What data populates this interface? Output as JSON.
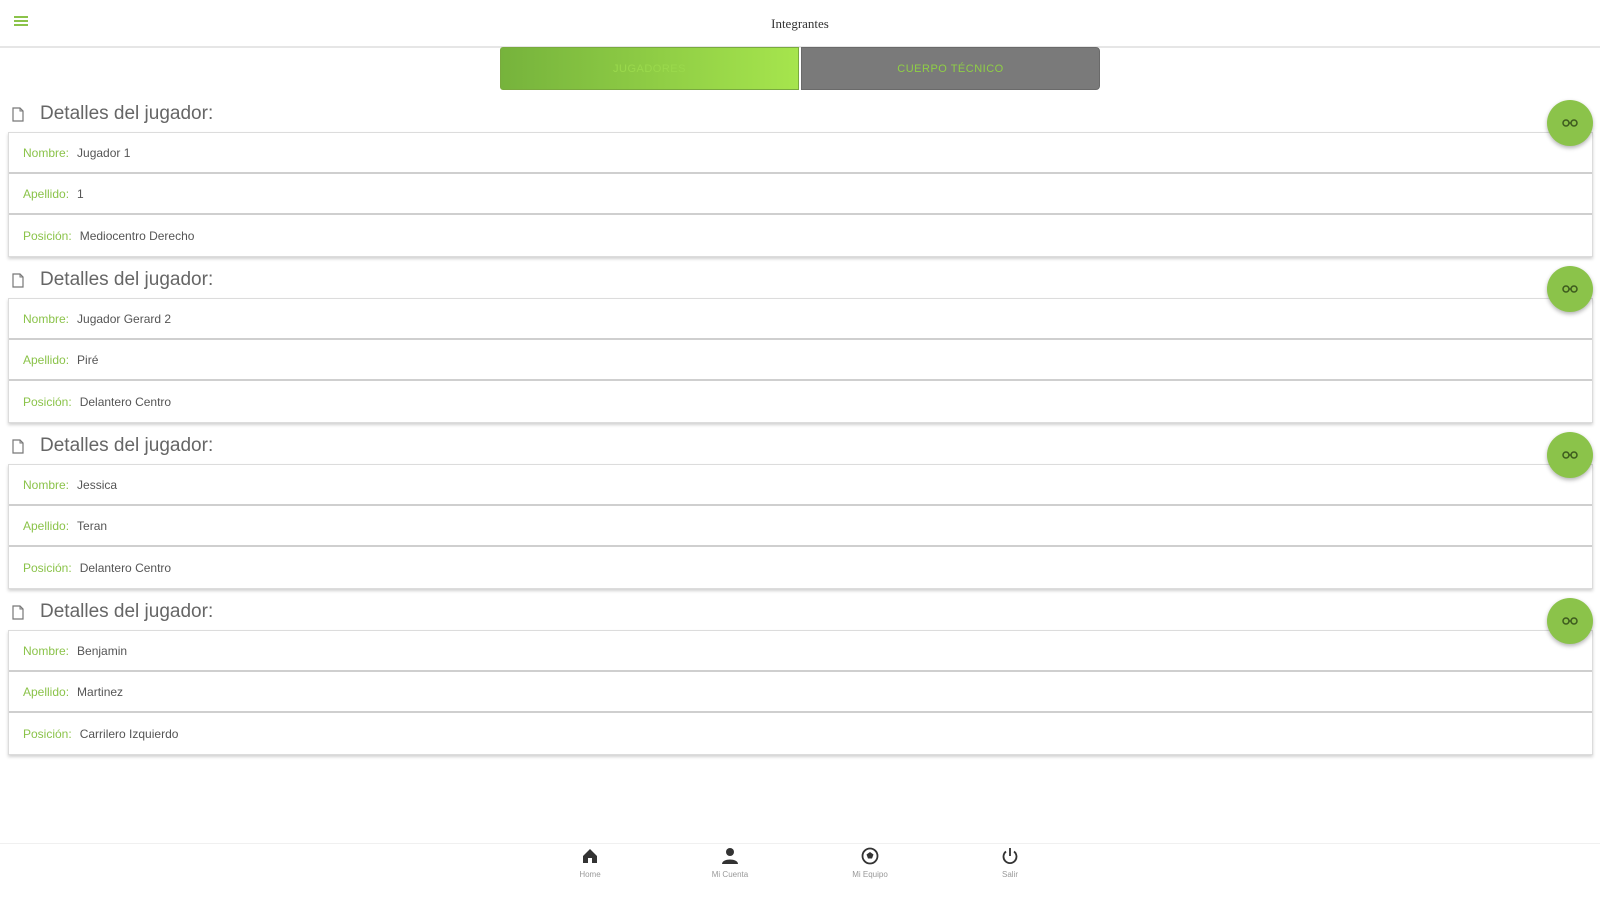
{
  "header": {
    "title": "Integrantes",
    "menu_icon": "hamburger-menu-icon"
  },
  "tabs": [
    {
      "label": "JUGADORES",
      "active": true
    },
    {
      "label": "CUERPO TÉCNICO",
      "active": false
    }
  ],
  "field_labels": {
    "nombre": "Nombre:",
    "apellido": "Apellido:",
    "posicion": "Posición:"
  },
  "players": [
    {
      "card_title": "Detalles del jugador:",
      "nombre": "Jugador 1",
      "apellido": "1",
      "posicion": "Mediocentro Derecho"
    },
    {
      "card_title": "Detalles del jugador:",
      "nombre": "Jugador Gerard 2",
      "apellido": "Piré",
      "posicion": "Delantero Centro"
    },
    {
      "card_title": "Detalles del jugador:",
      "nombre": "Jessica",
      "apellido": "Teran",
      "posicion": "Delantero Centro"
    },
    {
      "card_title": "Detalles del jugador:",
      "nombre": "Benjamin",
      "apellido": "Martinez",
      "posicion": "Carrilero Izquierdo"
    }
  ],
  "fab_icon": "glasses-view-icon",
  "bottom_nav": [
    {
      "label": "Home",
      "icon": "home-icon"
    },
    {
      "label": "Mi Cuenta",
      "icon": "person-icon"
    },
    {
      "label": "Mi Equipo",
      "icon": "soccer-ball-icon"
    },
    {
      "label": "Salir",
      "icon": "power-icon"
    }
  ],
  "colors": {
    "accent": "#8bc34a",
    "tab_gradient_start": "#76b33c",
    "tab_gradient_end": "#a6e54d",
    "tab_inactive": "#7a7a7a"
  }
}
